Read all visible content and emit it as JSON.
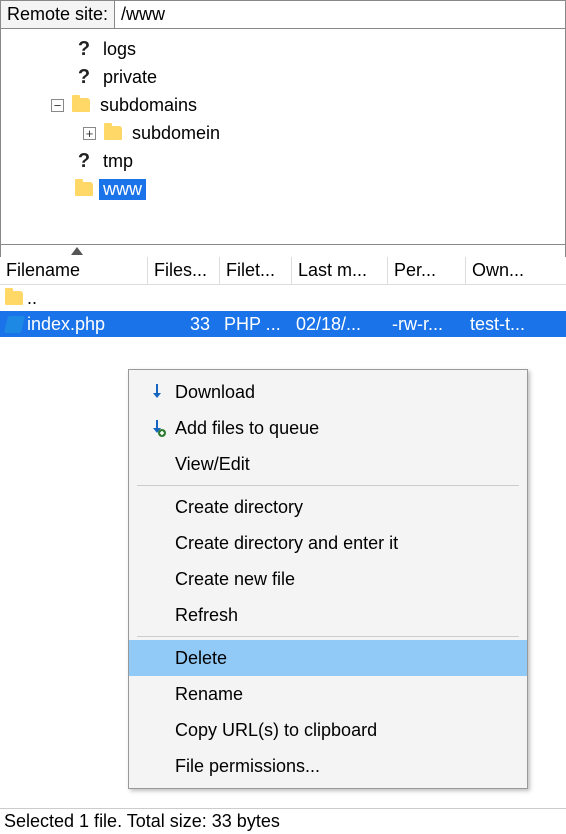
{
  "pathbar": {
    "label": "Remote site:",
    "value": "/www"
  },
  "tree": {
    "items": [
      {
        "icon": "question",
        "label": "logs"
      },
      {
        "icon": "question",
        "label": "private"
      },
      {
        "icon": "folder",
        "label": "subdomains",
        "expand": "minus"
      },
      {
        "icon": "folder",
        "label": "subdomein",
        "expand": "plus",
        "child": true
      },
      {
        "icon": "question",
        "label": "tmp"
      },
      {
        "icon": "folder",
        "label": "www",
        "selected": true
      }
    ]
  },
  "columns": {
    "name": "Filename",
    "size": "Files...",
    "type": "Filet...",
    "mod": "Last m...",
    "perm": "Per...",
    "own": "Own..."
  },
  "files": {
    "parent": "..",
    "row": {
      "name": "index.php",
      "size": "33",
      "type": "PHP ...",
      "mod": "02/18/...",
      "perm": "-rw-r...",
      "own": "test-t..."
    }
  },
  "menu": {
    "download": "Download",
    "queue": "Add files to queue",
    "viewedit": "View/Edit",
    "mkdir": "Create directory",
    "mkdir_enter": "Create directory and enter it",
    "newfile": "Create new file",
    "refresh": "Refresh",
    "delete": "Delete",
    "rename": "Rename",
    "copyurl": "Copy URL(s) to clipboard",
    "fileperm": "File permissions..."
  },
  "statusbar": "Selected 1 file. Total size: 33 bytes"
}
